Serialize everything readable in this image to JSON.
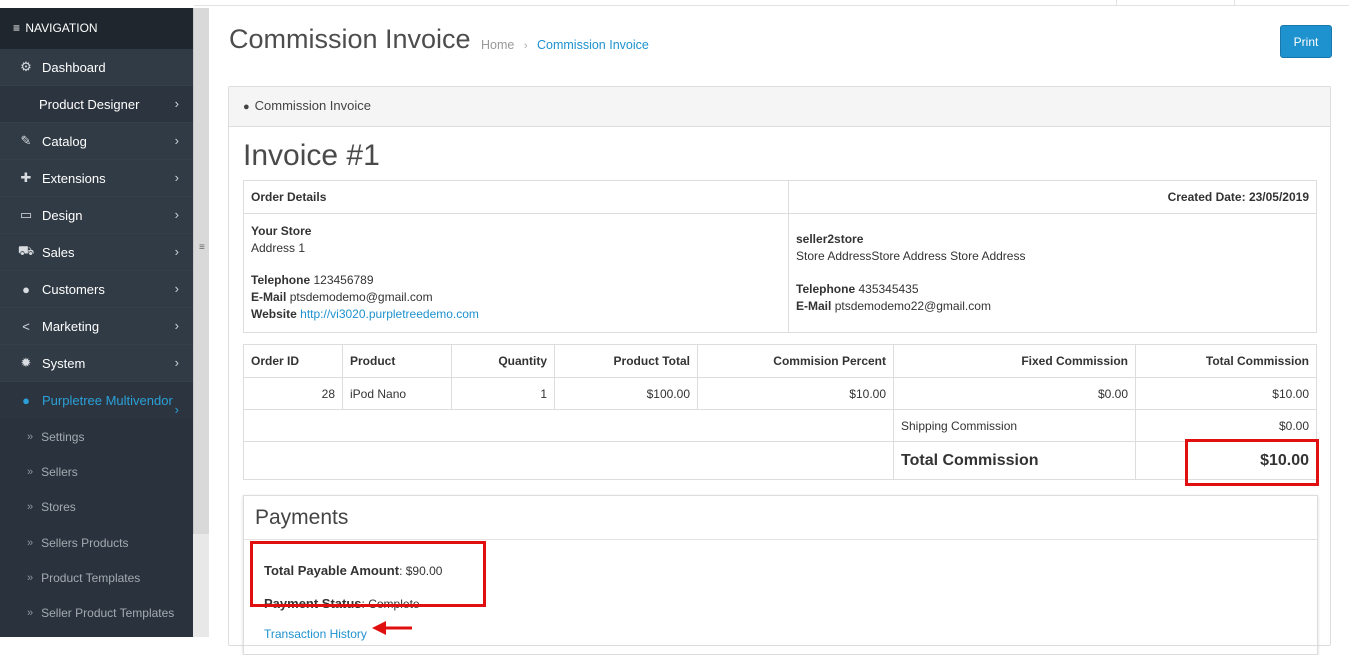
{
  "sidebar": {
    "header": "NAVIGATION",
    "items": [
      {
        "label": "Dashboard",
        "icon": "dashboard-icon",
        "glyph": "⚙",
        "chevron": false
      },
      {
        "label": "Product Designer",
        "icon": "",
        "glyph": "",
        "chevron": true,
        "indent": true
      },
      {
        "label": "Catalog",
        "icon": "tag-icon",
        "glyph": "✎",
        "chevron": true
      },
      {
        "label": "Extensions",
        "icon": "puzzle-icon",
        "glyph": "✚",
        "chevron": true
      },
      {
        "label": "Design",
        "icon": "monitor-icon",
        "glyph": "▭",
        "chevron": true
      },
      {
        "label": "Sales",
        "icon": "cart-icon",
        "glyph": "⛟",
        "chevron": true
      },
      {
        "label": "Customers",
        "icon": "user-icon",
        "glyph": "●",
        "chevron": true
      },
      {
        "label": "Marketing",
        "icon": "share-icon",
        "glyph": "<",
        "chevron": true
      },
      {
        "label": "System",
        "icon": "gear-icon",
        "glyph": "✹",
        "chevron": true
      }
    ],
    "active": {
      "label": "Purpletree Multivendor",
      "icon": "user-icon"
    },
    "subitems": [
      "Settings",
      "Sellers",
      "Stores",
      "Sellers Products",
      "Product Templates",
      "Seller Product Templates"
    ]
  },
  "header": {
    "title": "Commission Invoice",
    "breadcrumb": [
      "Home",
      "Commission Invoice"
    ],
    "print_label": "Print"
  },
  "panel": {
    "heading": "Commission Invoice",
    "invoice_title": "Invoice #1",
    "order_details_label": "Order Details",
    "created_date_label": "Created Date:",
    "created_date": "23/05/2019",
    "store": {
      "name": "Your Store",
      "address": "Address 1",
      "telephone_label": "Telephone",
      "telephone": "123456789",
      "email_label": "E-Mail",
      "email": "ptsdemodemo@gmail.com",
      "website_label": "Website",
      "website": "http://vi3020.purpletreedemo.com"
    },
    "seller": {
      "name": "seller2store",
      "address": "Store AddressStore Address Store Address",
      "telephone_label": "Telephone",
      "telephone": "435345435",
      "email_label": "E-Mail",
      "email": "ptsdemodemo22@gmail.com"
    },
    "table": {
      "headers": [
        "Order ID",
        "Product",
        "Quantity",
        "Product Total",
        "Commision Percent",
        "Fixed Commission",
        "Total Commission"
      ],
      "rows": [
        [
          "28",
          "iPod Nano",
          "1",
          "$100.00",
          "$10.00",
          "$0.00",
          "$10.00"
        ]
      ],
      "shipping_label": "Shipping Commission",
      "shipping_value": "$0.00",
      "total_label": "Total Commission",
      "total_value": "$10.00"
    },
    "payments": {
      "heading": "Payments",
      "payable_label": "Total Payable Amount",
      "payable_value": ": $90.00",
      "status_label": "Payment Status",
      "status_value": ": Complete",
      "history_link": "Transaction History"
    }
  },
  "colors": {
    "accent": "#1e91cf",
    "sidebar": "#2a333d",
    "highlight": "#e01010"
  }
}
